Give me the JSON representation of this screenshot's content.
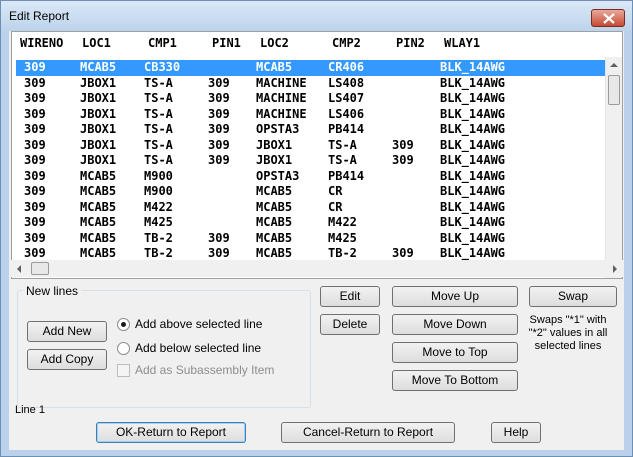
{
  "window": {
    "title": "Edit Report"
  },
  "table": {
    "headers": [
      "WIRENO",
      "LOC1",
      "CMP1",
      "PIN1",
      "LOC2",
      "CMP2",
      "PIN2",
      "WLAY1"
    ],
    "rows": [
      [
        "309",
        "MCAB5",
        "CB330",
        "",
        "MCAB5",
        "CR406",
        "",
        "BLK_14AWG"
      ],
      [
        "309",
        "JBOX1",
        "TS-A",
        "309",
        "MACHINE",
        "LS408",
        "",
        "BLK_14AWG"
      ],
      [
        "309",
        "JBOX1",
        "TS-A",
        "309",
        "MACHINE",
        "LS407",
        "",
        "BLK_14AWG"
      ],
      [
        "309",
        "JBOX1",
        "TS-A",
        "309",
        "MACHINE",
        "LS406",
        "",
        "BLK_14AWG"
      ],
      [
        "309",
        "JBOX1",
        "TS-A",
        "309",
        "OPSTA3",
        "PB414",
        "",
        "BLK_14AWG"
      ],
      [
        "309",
        "JBOX1",
        "TS-A",
        "309",
        "JBOX1",
        "TS-A",
        "309",
        "BLK_14AWG"
      ],
      [
        "309",
        "JBOX1",
        "TS-A",
        "309",
        "JBOX1",
        "TS-A",
        "309",
        "BLK_14AWG"
      ],
      [
        "309",
        "MCAB5",
        "M900",
        "",
        "OPSTA3",
        "PB414",
        "",
        "BLK_14AWG"
      ],
      [
        "309",
        "MCAB5",
        "M900",
        "",
        "MCAB5",
        "CR",
        "",
        "BLK_14AWG"
      ],
      [
        "309",
        "MCAB5",
        "M422",
        "",
        "MCAB5",
        "CR",
        "",
        "BLK_14AWG"
      ],
      [
        "309",
        "MCAB5",
        "M425",
        "",
        "MCAB5",
        "M422",
        "",
        "BLK_14AWG"
      ],
      [
        "309",
        "MCAB5",
        "TB-2",
        "309",
        "MCAB5",
        "M425",
        "",
        "BLK_14AWG"
      ],
      [
        "309",
        "MCAB5",
        "TB-2",
        "309",
        "MCAB5",
        "TB-2",
        "309",
        "BLK_14AWG"
      ]
    ],
    "selected_index": 0
  },
  "new_lines": {
    "group_label": "New lines",
    "add_new": "Add New",
    "add_copy": "Add Copy",
    "opt_above": "Add above selected line",
    "opt_below": "Add below selected line",
    "opt_subassembly": "Add as Subassembly Item",
    "selected_option": "above"
  },
  "actions": {
    "edit": "Edit",
    "delete": "Delete",
    "move_up": "Move Up",
    "move_down": "Move Down",
    "move_to_top": "Move to Top",
    "move_to_bottom": "Move To Bottom",
    "swap": "Swap",
    "swap_note": "Swaps \"*1\" with \"*2\" values in all selected lines"
  },
  "status": {
    "line": "Line 1"
  },
  "footer": {
    "ok": "OK-Return to Report",
    "cancel": "Cancel-Return to Report",
    "help": "Help"
  },
  "colors": {
    "selection": "#3399ff",
    "frame": "#b9d1ea"
  }
}
